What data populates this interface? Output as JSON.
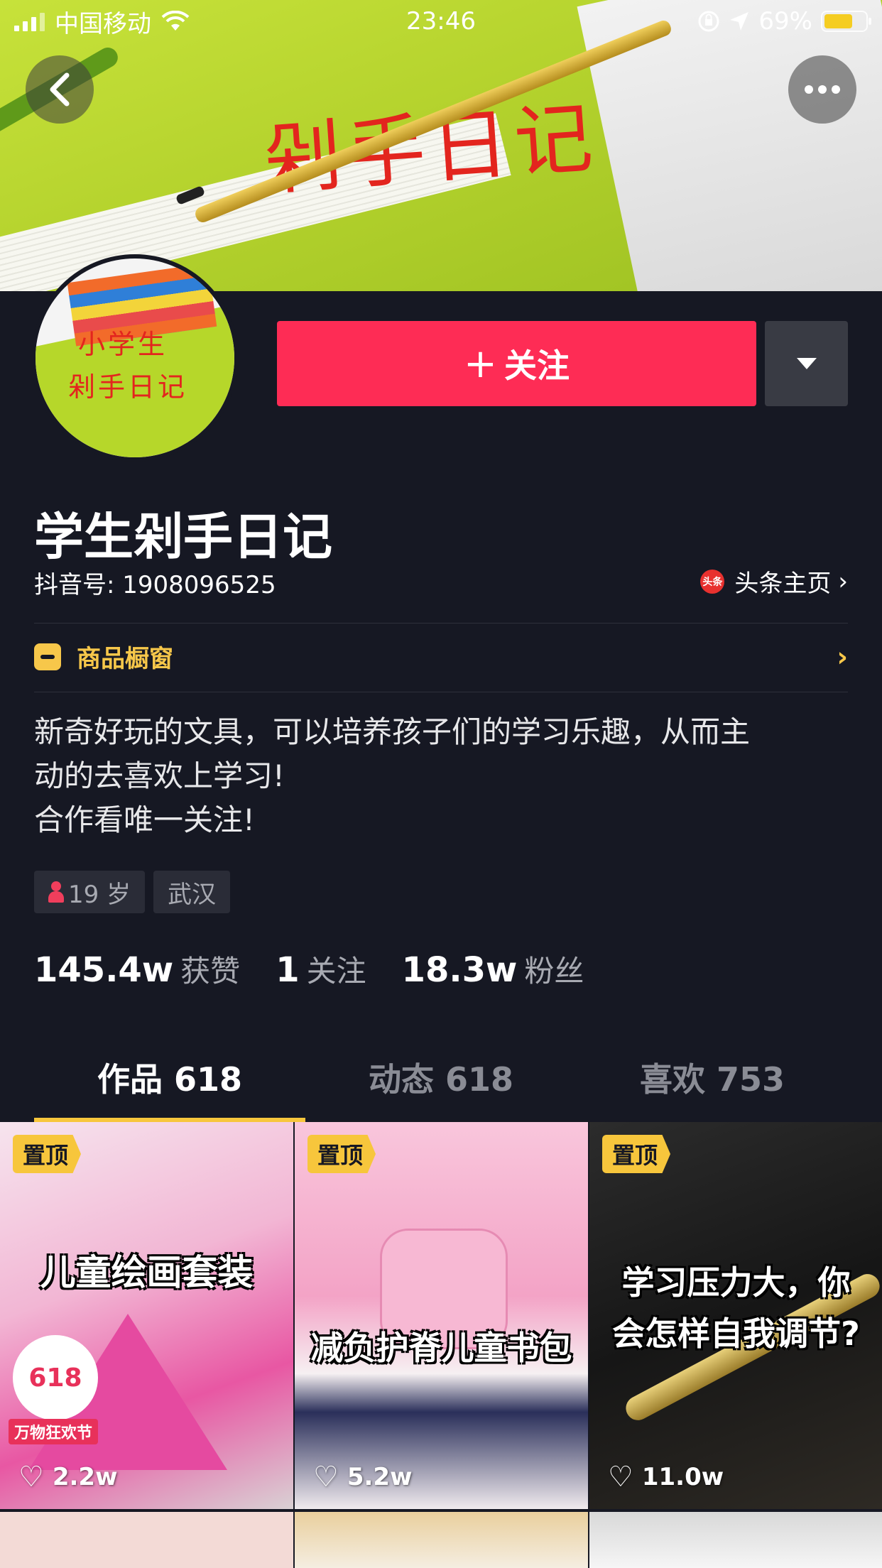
{
  "status_bar": {
    "carrier": "中国移动",
    "time": "23:46",
    "battery": "69%",
    "battery_level": 0.69
  },
  "header": {
    "back_icon": "chevron-left-icon",
    "more_icon": "more-dots-icon"
  },
  "cover_text": "剁手日记",
  "avatar_text": [
    "小学生",
    "剁手日记"
  ],
  "actions": {
    "follow_label": "关注",
    "follow_color": "#fe2c55"
  },
  "profile": {
    "name": "学生剁手日记",
    "uid": "抖音号: 1908096525",
    "toutiao_label": "头条主页",
    "toutiao_icon_text": "头条",
    "shop_label": "商品橱窗",
    "bio_lines": [
      "新奇好玩的文具，可以培养孩子们的学习乐趣，从而主",
      "动的去喜欢上学习!",
      "合作看唯一关注!"
    ],
    "tags": [
      "19 岁",
      "武汉"
    ]
  },
  "stats": [
    {
      "num": "145.4w",
      "label": "获赞"
    },
    {
      "num": "1",
      "label": "关注"
    },
    {
      "num": "18.3w",
      "label": "粉丝"
    }
  ],
  "tabs": [
    {
      "label": "作品 618",
      "active": true
    },
    {
      "label": "动态 618",
      "active": false
    },
    {
      "label": "喜欢 753",
      "active": false
    }
  ],
  "accent_color": "#f7c63c",
  "videos": [
    {
      "pin": "置顶",
      "title": "儿童绘画套装",
      "badge": "618",
      "badge_sub": "万物狂欢节",
      "likes": "2.2w"
    },
    {
      "pin": "置顶",
      "title": "减负护脊儿童书包",
      "likes": "5.2w"
    },
    {
      "pin": "置顶",
      "title_lines": [
        "学习压力大，你",
        "会怎样自我调节?"
      ],
      "likes": "11.0w"
    }
  ]
}
